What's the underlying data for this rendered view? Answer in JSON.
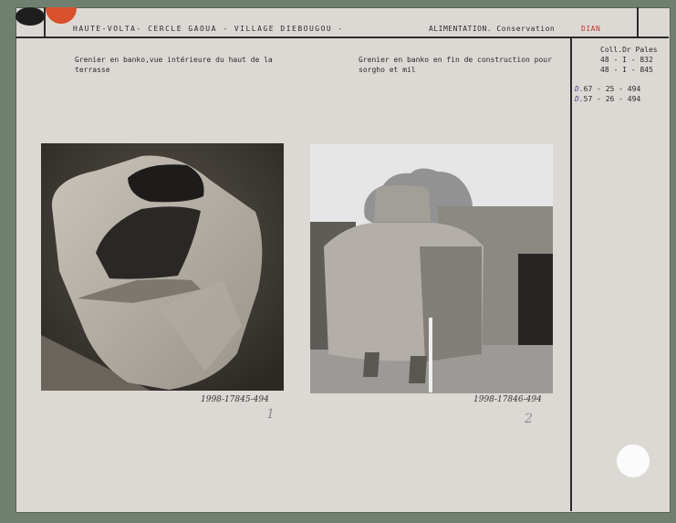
{
  "header": {
    "title": "HAUTE-VOLTA- CERCLE GAOUA - VILLAGE DIEBOUGOU -",
    "category": "ALIMENTATION. Conservation",
    "ethnic_group": "DIAN"
  },
  "photos": [
    {
      "caption": "Grenier en banko,vue intérieure du haut de la terrasse",
      "inventory": "1998-17845-494",
      "number": "1"
    },
    {
      "caption": "Grenier en banko en fin de construction pour sorgho et mil",
      "inventory": "1998-17846-494",
      "number": "2"
    }
  ],
  "references": {
    "collection": "Coll.Dr Pales",
    "lines": [
      "48 - I - 832",
      "48 - I - 845"
    ],
    "inventory_lines": [
      {
        "prefix": "D.",
        "value": "67 - 25 - 494"
      },
      {
        "prefix": "D.",
        "value": "57 - 26 - 494"
      }
    ]
  },
  "colors": {
    "mount": "#6f8070",
    "card": "#dcd9d4",
    "accent_red": "#d8502c",
    "ink_purple": "#5a3a9a"
  }
}
